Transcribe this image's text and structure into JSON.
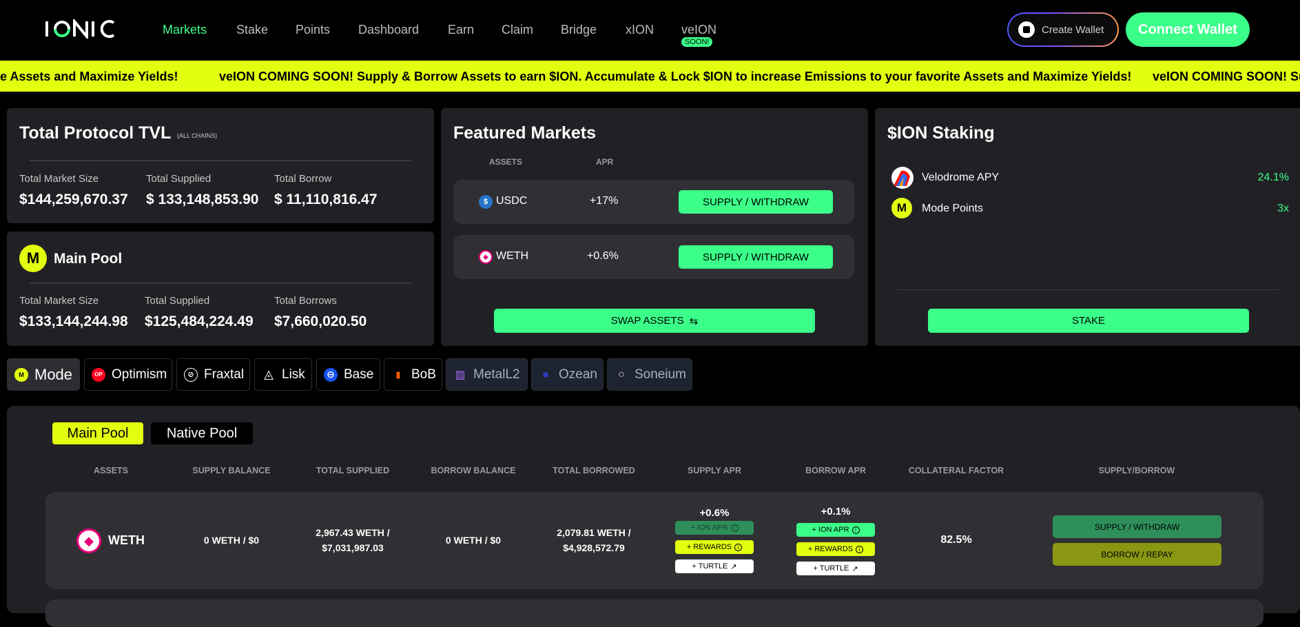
{
  "header": {
    "logo_text": "IONIC",
    "nav": [
      {
        "label": "Markets",
        "active": true
      },
      {
        "label": "Stake"
      },
      {
        "label": "Points"
      },
      {
        "label": "Dashboard"
      },
      {
        "label": "Earn"
      },
      {
        "label": "Claim"
      },
      {
        "label": "Bridge"
      },
      {
        "label": "xION"
      },
      {
        "label": "veION",
        "badge": "SOON!"
      }
    ],
    "create_wallet_label": "Create Wallet",
    "connect_wallet_label": "Connect Wallet"
  },
  "ticker": {
    "segments": [
      "e Assets and Maximize Yields!",
      "veION COMING SOON! Supply & Borrow Assets to earn $ION. Accumulate & Lock $ION to increase Emissions to your favorite Assets and Maximize Yields!",
      "veION COMING SOON! Su"
    ]
  },
  "tvl": {
    "title": "Total Protocol TVL",
    "title_note": "(ALL CHAINS)",
    "stats": [
      {
        "label": "Total Market Size",
        "value": "$144,259,670.37"
      },
      {
        "label": "Total Supplied",
        "value": "$ 133,148,853.90"
      },
      {
        "label": "Total Borrow",
        "value": "$ 11,110,816.47"
      }
    ]
  },
  "main_pool": {
    "badge": "M",
    "title": "Main Pool",
    "stats": [
      {
        "label": "Total Market Size",
        "value": "$133,144,244.98"
      },
      {
        "label": "Total Supplied",
        "value": "$125,484,224.49"
      },
      {
        "label": "Total Borrows",
        "value": "$7,660,020.50"
      }
    ]
  },
  "featured": {
    "title": "Featured Markets",
    "col_assets": "ASSETS",
    "col_apr": "APR",
    "rows": [
      {
        "asset": "USDC",
        "apr": "+17%",
        "button": "SUPPLY / WITHDRAW"
      },
      {
        "asset": "WETH",
        "apr": "+0.6%",
        "button": "SUPPLY / WITHDRAW"
      }
    ],
    "swap_label": "SWAP ASSETS",
    "swap_icon": "⇆"
  },
  "staking": {
    "title": "$ION Staking",
    "rows": [
      {
        "label": "Velodrome APY",
        "value": "24.1%"
      },
      {
        "label": "Mode Points",
        "value": "3x",
        "badge": "M"
      }
    ],
    "stake_label": "STAKE"
  },
  "chains": [
    {
      "label": "Mode",
      "icon": "M",
      "active": true
    },
    {
      "label": "Optimism",
      "icon": "OP"
    },
    {
      "label": "Fraxtal",
      "icon": "⊘"
    },
    {
      "label": "Lisk",
      "icon": "◬"
    },
    {
      "label": "Base",
      "icon": "⊖"
    },
    {
      "label": "BoB",
      "icon": "▮"
    },
    {
      "label": "MetalL2",
      "icon": "▥",
      "dim": true
    },
    {
      "label": "Ozean",
      "icon": "●",
      "dim": true
    },
    {
      "label": "Soneium",
      "icon": "○",
      "dim": true
    }
  ],
  "pool_tabs": [
    {
      "label": "Main Pool",
      "active": true
    },
    {
      "label": "Native Pool"
    }
  ],
  "table": {
    "headers": [
      "ASSETS",
      "SUPPLY BALANCE",
      "TOTAL SUPPLIED",
      "BORROW BALANCE",
      "TOTAL BORROWED",
      "SUPPLY APR",
      "BORROW APR",
      "COLLATERAL FACTOR",
      "SUPPLY/BORROW"
    ],
    "rows": [
      {
        "asset": "WETH",
        "supply_balance": "0 WETH / $0",
        "total_supplied_1": "2,967.43 WETH /",
        "total_supplied_2": "$7,031,987.03",
        "borrow_balance": "0 WETH / $0",
        "total_borrowed_1": "2,079.81 WETH /",
        "total_borrowed_2": "$4,928,572.79",
        "supply_apr": "+0.6%",
        "borrow_apr": "+0.1%",
        "ion_apr": "+ ION APR",
        "rewards": "+ REWARDS",
        "turtle": "+ TURTLE",
        "collateral_factor": "82.5%",
        "supply_button": "SUPPLY / WITHDRAW",
        "borrow_button": "BORROW / REPAY"
      }
    ]
  },
  "colors": {
    "accent_green": "#3bff89",
    "accent_yellow": "#e2ff0f",
    "card_bg": "#212125"
  }
}
